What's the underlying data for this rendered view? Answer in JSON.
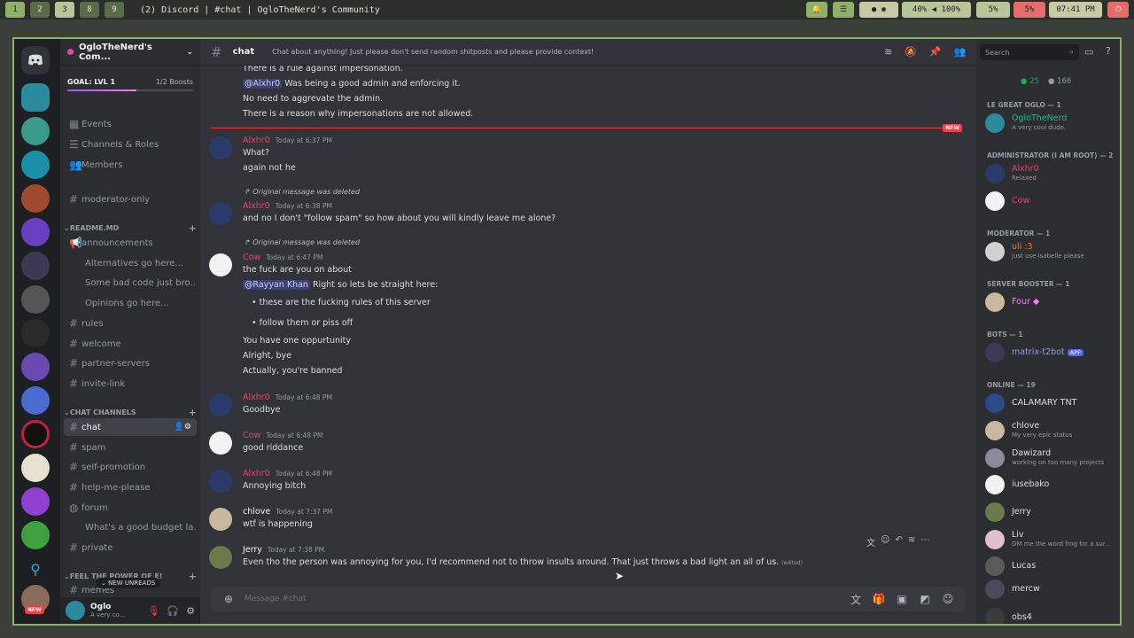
{
  "topbar": {
    "workspaces": [
      "1",
      "2",
      "3",
      "8",
      "9"
    ],
    "window_title": "(2) Discord | #chat | OgloTheNerd's Community",
    "audio": "40%  ◀  100%",
    "cpu": "5%",
    "mem": "5%",
    "clock": "07:41 PM"
  },
  "guild": {
    "name": "OgloTheNerd's Com...",
    "goal_label": "GOAL: LVL 1",
    "boosts": "1/2 Boosts",
    "top_items": [
      "Events",
      "Channels & Roles",
      "Members"
    ],
    "moderator_only": "moderator-only",
    "cat_readme": "README.MD",
    "announcements": "announcements",
    "threads_readme": [
      "Alternatives go here...",
      "Some bad code just bro...",
      "Opinions go here..."
    ],
    "readme_channels": [
      "rules",
      "welcome",
      "partner-servers",
      "invite-link"
    ],
    "cat_chat": "CHAT CHANNELS",
    "chat_channels": [
      "chat",
      "spam",
      "self-promotion",
      "help-me-please",
      "forum"
    ],
    "forum_thread": "What's a good budget la...",
    "private": "private",
    "cat_feel": "FEEL THE POWER OF E!",
    "new_unreads": "NEW UNREADS",
    "partial_channel": "memes"
  },
  "user": {
    "name": "Oglo",
    "status": "A very co..."
  },
  "channel": {
    "name": "chat",
    "topic": "Chat about anything! Just please don't send random shitposts and please provide context!",
    "search_placeholder": "Search",
    "composer_placeholder": "Message #chat"
  },
  "messages": {
    "top_lines": [
      "There is a rule against impersonation.",
      "Was being a good admin and enforcing it.",
      "No need to aggrevate the admin.",
      "There is a reason why impersonations are not allowed."
    ],
    "top_mention": "@Alxhr0",
    "new_label": "NEW",
    "m1": {
      "author": "Alxhr0",
      "time": "Today at 6:37 PM",
      "lines": [
        "What?",
        "again not he"
      ]
    },
    "m2": {
      "reply": "Original message was deleted",
      "author": "Alxhr0",
      "time": "Today at 6:38 PM",
      "text": "and no I don't \"follow spam\" so how about you will kindly leave me alone?"
    },
    "m3": {
      "reply": "Original message was deleted",
      "author": "Cow",
      "time": "Today at 6:47 PM",
      "line1": "the fuck are you on about",
      "mention": "@Rayyan Khan",
      "line2": "Right so lets be straight here:",
      "bullets": [
        "these are the fucking rules of this server",
        "follow them or piss off"
      ],
      "lines": [
        "You have one oppurtunity",
        "Alright, bye",
        "Actually, you're banned"
      ]
    },
    "m4": {
      "author": "Alxhr0",
      "time": "Today at 6:48 PM",
      "text": "Goodbye"
    },
    "m5": {
      "author": "Cow",
      "time": "Today at 6:48 PM",
      "text": "good riddance"
    },
    "m6": {
      "author": "Alxhr0",
      "time": "Today at 6:48 PM",
      "text": "Annoying bitch"
    },
    "m7": {
      "author": "chlove",
      "time": "Today at 7:37 PM",
      "text": "wtf is happening"
    },
    "m8": {
      "author": "Jerry",
      "time": "Today at 7:38 PM",
      "text": "Even tho the person was annoying for you, I'd recommend not to throw insults around. That just throws a bad light an all of us.",
      "edited": "(edited)"
    }
  },
  "members": {
    "online_count": "25",
    "member_count": "166",
    "cat_oglo": "LE GREAT OGLO — 1",
    "oglo": {
      "name": "OgloTheNerd",
      "status": "A very cool dude."
    },
    "cat_admin": "ADMINISTRATOR (I AM ROOT) — 2",
    "alxhr0": {
      "name": "Alxhr0",
      "status": "Relaxed"
    },
    "cow": {
      "name": "Cow"
    },
    "cat_mod": "MODERATOR — 1",
    "uli": {
      "name": "uli :3",
      "status": "just use Isabelle please"
    },
    "cat_booster": "SERVER BOOSTER — 1",
    "four": {
      "name": "Four"
    },
    "cat_bots": "BOTS — 1",
    "bot": {
      "name": "matrix-t2bot",
      "tag": "APP"
    },
    "cat_online": "ONLINE — 19",
    "online": [
      {
        "name": "CALAMARY TNT",
        "status": ""
      },
      {
        "name": "chlove",
        "status": "My very epic status"
      },
      {
        "name": "Dawizard",
        "status": "working on too many projects"
      },
      {
        "name": "iusebako",
        "status": ""
      },
      {
        "name": "Jerry",
        "status": ""
      },
      {
        "name": "Liv",
        "status": "DM me the word frog for a sur..."
      },
      {
        "name": "Lucas",
        "status": ""
      },
      {
        "name": "mercw",
        "status": ""
      },
      {
        "name": "obs4",
        "status": ""
      }
    ]
  }
}
